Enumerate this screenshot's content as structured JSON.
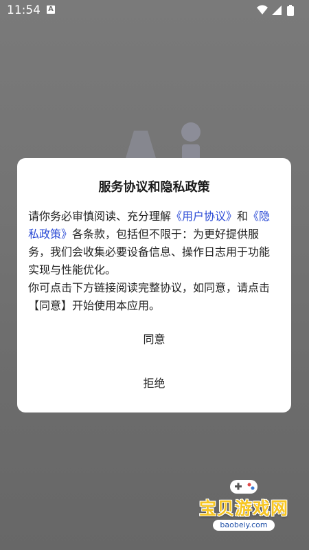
{
  "status_bar": {
    "time": "11:54",
    "indicator": "A",
    "icons": [
      "wifi-icon",
      "signal-icon",
      "battery-icon"
    ]
  },
  "dialog": {
    "title": "服务协议和隐私政策",
    "body": {
      "p1_prefix": "请你务必审慎阅读、充分理解",
      "user_agreement_link": "《用户协议》",
      "p1_and": "和",
      "privacy_policy_link": "《隐私政策》",
      "p1_suffix": "各条款，包括但不限于：为更好提供服务，我们会收集必要设备信息、操作日志用于功能实现与性能优化。",
      "p2": "你可点击下方链接阅读完整协议，如同意，请点击【同意】开始使用本应用。"
    },
    "agree_label": "同意",
    "refuse_label": "拒绝"
  },
  "watermark": {
    "title": "宝贝游戏网",
    "url": "baobeiy.com"
  },
  "colors": {
    "link": "#2b4bd6",
    "overlay": "#6f6f6f",
    "dialog_bg": "#ffffff",
    "watermark_gold": "#f7c623"
  }
}
